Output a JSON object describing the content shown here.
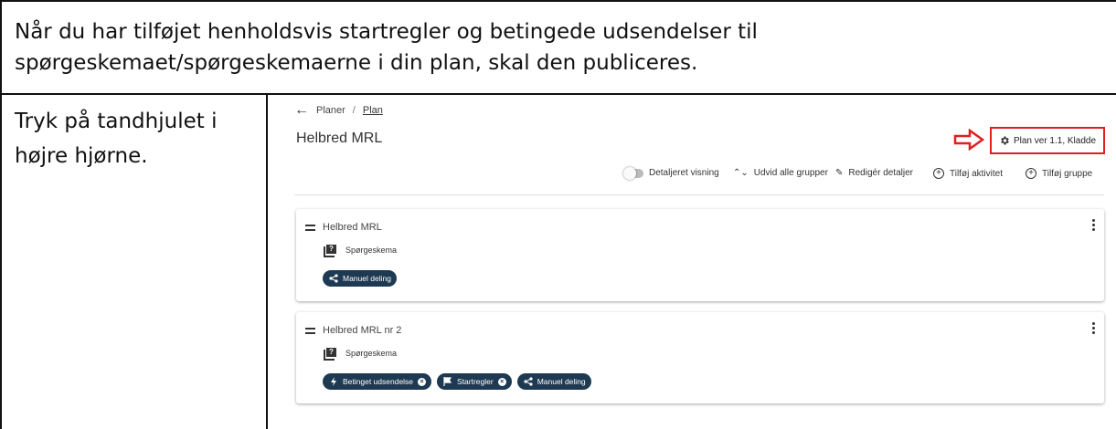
{
  "instructions": {
    "intro": "Når du har tilføjet henholdsvis startregler og betingede udsendelser til spørgeskemaet/spørgeskemaerne i din plan, skal den publiceres.",
    "step": "Tryk på tandhjulet i højre hjørne."
  },
  "app": {
    "breadcrumb": {
      "parent": "Planer",
      "separator": "/",
      "current": "Plan"
    },
    "title": "Helbred MRL",
    "plan_button_label": "Plan ver 1.1, Kladde",
    "highlight_color": "#e02020",
    "toolbar": {
      "detailed_view": "Detaljeret visning",
      "expand_groups": "Udvid alle grupper",
      "edit_details": "Redigér detaljer",
      "add_activity": "Tilføj aktivitet",
      "add_group": "Tilføj gruppe"
    },
    "groups": [
      {
        "title": "Helbred MRL",
        "item": "Spørgeskema",
        "chips": [
          "Manuel deling"
        ]
      },
      {
        "title": "Helbred MRL nr 2",
        "item": "Spørgeskema",
        "chips": [
          "Betinget udsendelse",
          "Startregler",
          "Manuel deling"
        ]
      }
    ],
    "chip_color": "#1e3a52"
  }
}
